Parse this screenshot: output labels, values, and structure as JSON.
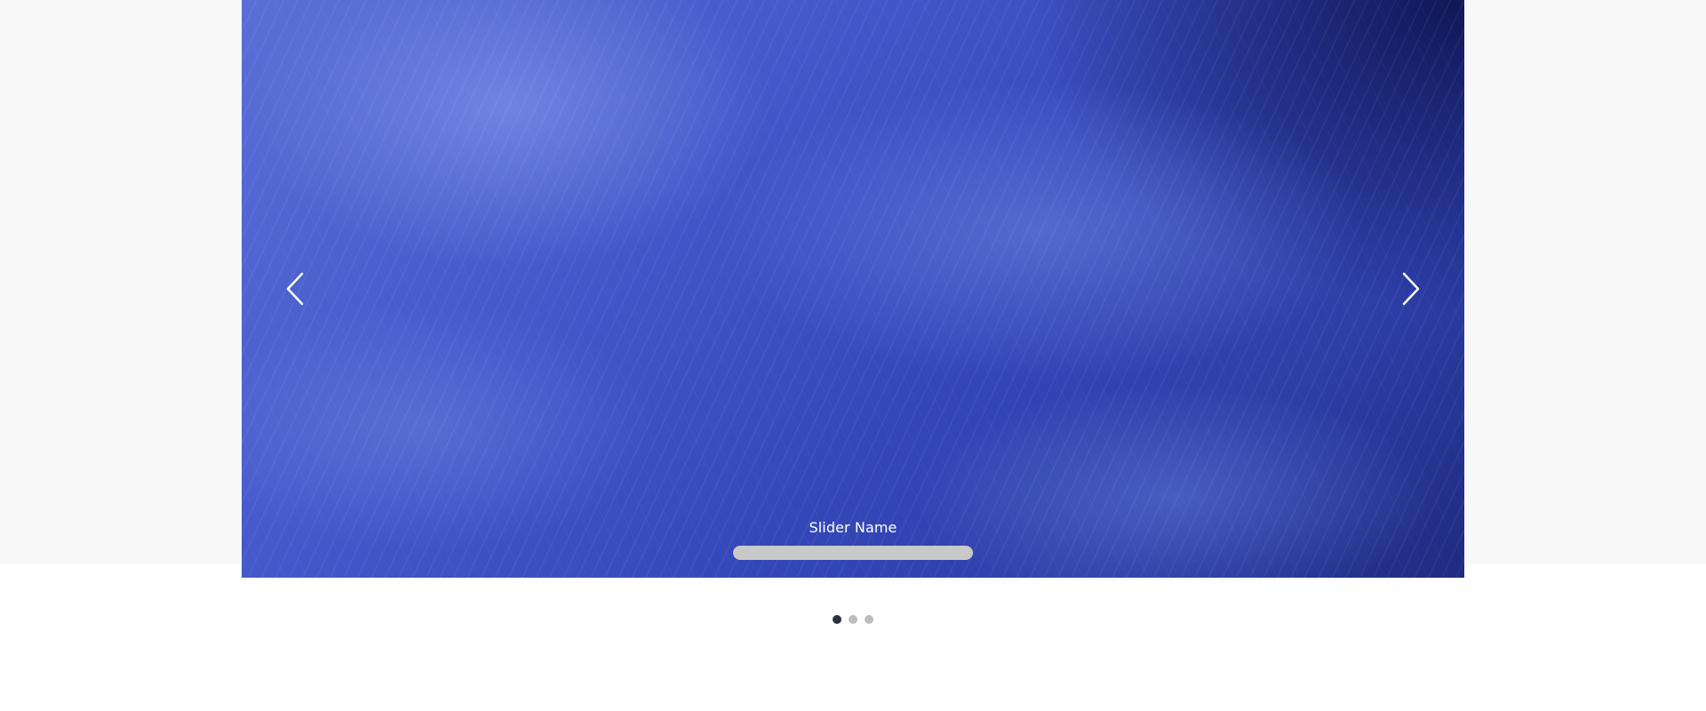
{
  "slider": {
    "caption": "Slider Name",
    "prev_icon": "chevron-left-icon",
    "next_icon": "chevron-right-icon",
    "active_slide": 1,
    "slide_count": 3
  },
  "pagination": {
    "dots": [
      {
        "state": "active"
      },
      {
        "state": "inactive"
      },
      {
        "state": "inactive"
      }
    ]
  },
  "colors": {
    "page_background": "#f8f8f8",
    "active_dot": "#2b3140",
    "inactive_dot": "#bdbdbd",
    "caption_bar": "#c9c9c9"
  }
}
